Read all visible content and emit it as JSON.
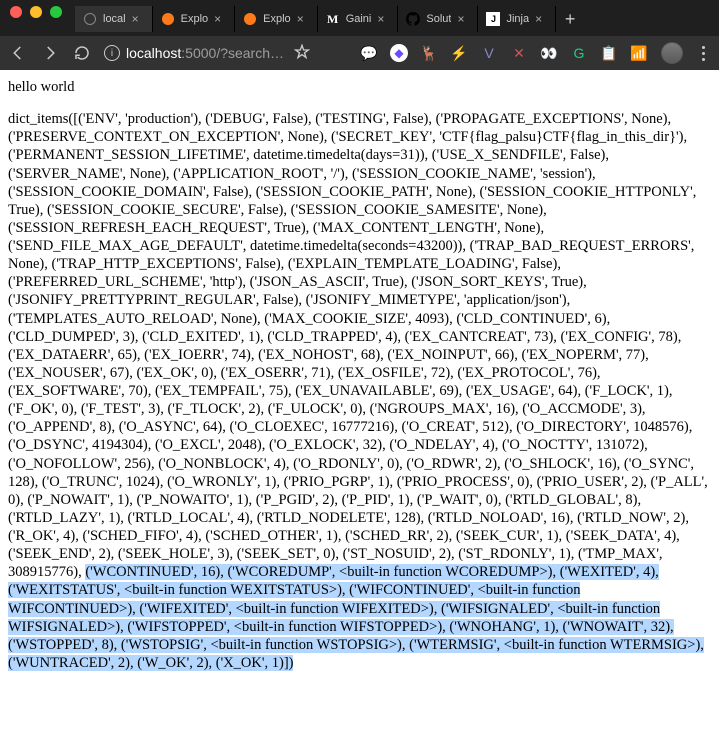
{
  "window": {
    "url_host": "localhost",
    "url_port": ":5000",
    "url_path": "/?search…"
  },
  "tabs": [
    {
      "title": "local",
      "active": true,
      "favicon": "globe"
    },
    {
      "title": "Explo",
      "active": false,
      "favicon": "orange"
    },
    {
      "title": "Explo",
      "active": false,
      "favicon": "orange"
    },
    {
      "title": "Gaini",
      "active": false,
      "favicon": "m"
    },
    {
      "title": "Solut",
      "active": false,
      "favicon": "github"
    },
    {
      "title": "Jinja",
      "active": false,
      "favicon": "jinja"
    }
  ],
  "page": {
    "greeting": "hello world",
    "dict_prefix": "dict_items([('ENV', 'production'), ('DEBUG', False), ('TESTING', False), ('PROPAGATE_EXCEPTIONS', None), ('PRESERVE_CONTEXT_ON_EXCEPTION', None), ('SECRET_KEY', 'CTF{flag_palsu}CTF{flag_in_this_dir}'), ('PERMANENT_SESSION_LIFETIME', datetime.timedelta(days=31)), ('USE_X_SENDFILE', False), ('SERVER_NAME', None), ('APPLICATION_ROOT', '/'), ('SESSION_COOKIE_NAME', 'session'), ('SESSION_COOKIE_DOMAIN', False), ('SESSION_COOKIE_PATH', None), ('SESSION_COOKIE_HTTPONLY', True), ('SESSION_COOKIE_SECURE', False), ('SESSION_COOKIE_SAMESITE', None), ('SESSION_REFRESH_EACH_REQUEST', True), ('MAX_CONTENT_LENGTH', None), ('SEND_FILE_MAX_AGE_DEFAULT', datetime.timedelta(seconds=43200)), ('TRAP_BAD_REQUEST_ERRORS', None), ('TRAP_HTTP_EXCEPTIONS', False), ('EXPLAIN_TEMPLATE_LOADING', False), ('PREFERRED_URL_SCHEME', 'http'), ('JSON_AS_ASCII', True), ('JSON_SORT_KEYS', True), ('JSONIFY_PRETTYPRINT_REGULAR', False), ('JSONIFY_MIMETYPE', 'application/json'), ('TEMPLATES_AUTO_RELOAD', None), ('MAX_COOKIE_SIZE', 4093), ('CLD_CONTINUED', 6), ('CLD_DUMPED', 3), ('CLD_EXITED', 1), ('CLD_TRAPPED', 4), ('EX_CANTCREAT', 73), ('EX_CONFIG', 78), ('EX_DATAERR', 65), ('EX_IOERR', 74), ('EX_NOHOST', 68), ('EX_NOINPUT', 66), ('EX_NOPERM', 77), ('EX_NOUSER', 67), ('EX_OK', 0), ('EX_OSERR', 71), ('EX_OSFILE', 72), ('EX_PROTOCOL', 76), ('EX_SOFTWARE', 70), ('EX_TEMPFAIL', 75), ('EX_UNAVAILABLE', 69), ('EX_USAGE', 64), ('F_LOCK', 1), ('F_OK', 0), ('F_TEST', 3), ('F_TLOCK', 2), ('F_ULOCK', 0), ('NGROUPS_MAX', 16), ('O_ACCMODE', 3), ('O_APPEND', 8), ('O_ASYNC', 64), ('O_CLOEXEC', 16777216), ('O_CREAT', 512), ('O_DIRECTORY', 1048576), ('O_DSYNC', 4194304), ('O_EXCL', 2048), ('O_EXLOCK', 32), ('O_NDELAY', 4), ('O_NOCTTY', 131072), ('O_NOFOLLOW', 256), ('O_NONBLOCK', 4), ('O_RDONLY', 0), ('O_RDWR', 2), ('O_SHLOCK', 16), ('O_SYNC', 128), ('O_TRUNC', 1024), ('O_WRONLY', 1), ('PRIO_PGRP', 1), ('PRIO_PROCESS', 0), ('PRIO_USER', 2), ('P_ALL', 0), ('P_NOWAIT', 1), ('P_NOWAITO', 1), ('P_PGID', 2), ('P_PID', 1), ('P_WAIT', 0), ('RTLD_GLOBAL', 8), ('RTLD_LAZY', 1), ('RTLD_LOCAL', 4), ('RTLD_NODELETE', 128), ('RTLD_NOLOAD', 16), ('RTLD_NOW', 2), ('R_OK', 4), ('SCHED_FIFO', 4), ('SCHED_OTHER', 1), ('SCHED_RR', 2), ('SEEK_CUR', 1), ('SEEK_DATA', 4), ('SEEK_END', 2), ('SEEK_HOLE', 3), ('SEEK_SET', 0), ('ST_NOSUID', 2), ('ST_RDONLY', 1), ('TMP_MAX', 308915776), ",
    "dict_highlighted": "('WCONTINUED', 16), ('WCOREDUMP', <built-in function WCOREDUMP>), ('WEXITED', 4), ('WEXITSTATUS', <built-in function WEXITSTATUS>), ('WIFCONTINUED', <built-in function WIFCONTINUED>), ('WIFEXITED', <built-in function WIFEXITED>), ('WIFSIGNALED', <built-in function WIFSIGNALED>), ('WIFSTOPPED', <built-in function WIFSTOPPED>), ('WNOHANG', 1), ('WNOWAIT', 32), ('WSTOPPED', 8), ('WSTOPSIG', <built-in function WSTOPSIG>), ('WTERMSIG', <built-in function WTERMSIG>), ('WUNTRACED', 2), ('W_OK', 2), ('X_OK', 1)])"
  },
  "ext_icons": [
    "💬",
    "◆",
    "🦌",
    "⚡",
    "V",
    "✕",
    "👀",
    "G",
    "📋",
    "📶"
  ]
}
